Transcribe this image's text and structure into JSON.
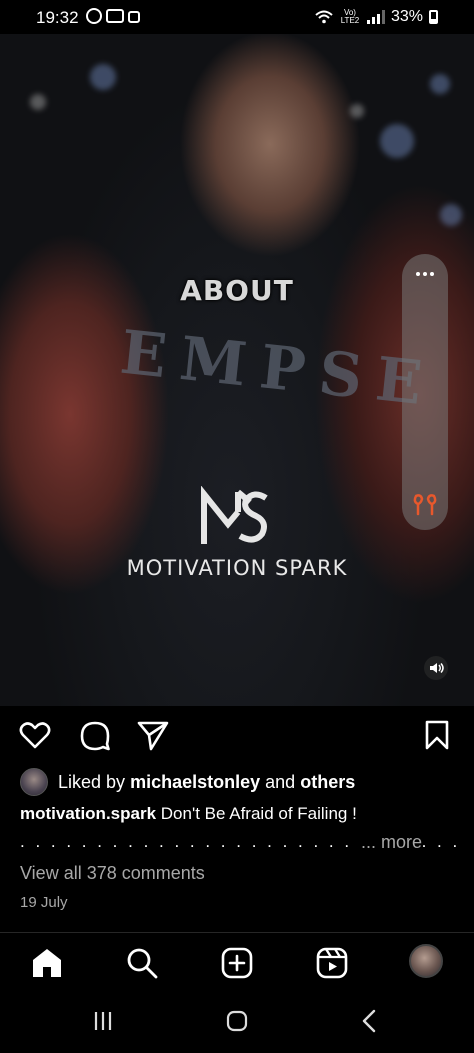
{
  "status_bar": {
    "time": "19:32",
    "network_label": "Vo) LTE2",
    "battery": "33%"
  },
  "video": {
    "overlay_text": "ABOUT",
    "shirt_text": "EMPSE",
    "brand_name": "MOTIVATION SPARK"
  },
  "post": {
    "liked_prefix": "Liked by",
    "liked_user": "michaelstonley",
    "liked_and": "and",
    "liked_others": "others",
    "username": "motivation.spark",
    "caption": "Don't Be Afraid of Failing !",
    "dots": ". . . . . . . . . . . . . . . . . . . . . . . . . . . . . . . . . . . . . . . .",
    "more": "... more",
    "view_comments": "View all 378 comments",
    "date": "19 July"
  },
  "icons": {
    "like": "heart-icon",
    "comment": "comment-icon",
    "share": "send-icon",
    "save": "bookmark-icon",
    "home": "home-icon",
    "search": "search-icon",
    "create": "plus-square-icon",
    "reels": "reels-icon",
    "earbuds_color": "#e8582c"
  }
}
